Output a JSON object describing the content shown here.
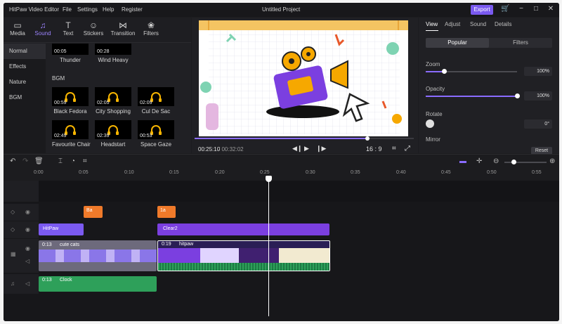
{
  "app": {
    "name": "HitPaw Video Editor",
    "menu": [
      "File",
      "Settings",
      "Help",
      "Register"
    ],
    "project_title": "Untitled Project",
    "export_label": "Export"
  },
  "media_tabs": [
    {
      "label": "Media",
      "icon": "folder-icon"
    },
    {
      "label": "Sound",
      "icon": "music-note-icon"
    },
    {
      "label": "Text",
      "icon": "text-icon"
    },
    {
      "label": "Stickers",
      "icon": "smiley-icon"
    },
    {
      "label": "Transition",
      "icon": "transition-icon"
    },
    {
      "label": "Filters",
      "icon": "filters-icon"
    }
  ],
  "active_media_tab": "Sound",
  "categories": [
    "Normal",
    "Effects",
    "Nature",
    "BGM"
  ],
  "active_category": "Normal",
  "sounds_top": [
    {
      "duration": "00:05",
      "name": "Thunder"
    },
    {
      "duration": "00:28",
      "name": "Wind Heavy"
    }
  ],
  "bgm_label": "BGM",
  "sounds_bgm": [
    {
      "duration": "00:59",
      "name": "Black Fedora"
    },
    {
      "duration": "02:05",
      "name": "City Shopping"
    },
    {
      "duration": "02:09",
      "name": "Cul De Sac"
    },
    {
      "duration": "02:49",
      "name": "Favourite Chair"
    },
    {
      "duration": "02:39",
      "name": "Headstart"
    },
    {
      "duration": "00:53",
      "name": "Space Gaze"
    }
  ],
  "preview": {
    "current_time": "00:25:10",
    "total_time": "/ 00:32:02",
    "progress": 0.79,
    "aspect_ratio": "16 : 9"
  },
  "props": {
    "tabs": [
      "View",
      "Adjust",
      "Sound",
      "Details"
    ],
    "active_tab": "View",
    "segments": [
      "Popular",
      "Filters"
    ],
    "zoom_label": "Zoom",
    "zoom_value": "100%",
    "zoom_level": 0.2,
    "opacity_label": "Opacity",
    "opacity_value": "100%",
    "opacity_level": 1.0,
    "rotate_label": "Rotate",
    "rotate_value": "0°",
    "mirror_label": "Mirror",
    "reset_label": "Reset"
  },
  "ruler_ticks": [
    "0:00",
    "0:05",
    "0:10",
    "0:15",
    "0:20",
    "0:25",
    "0:30",
    "0:35",
    "0:40",
    "0:45",
    "0:50",
    "0:55"
  ],
  "clips": {
    "sticker1": "Ba",
    "sticker2": "1a",
    "text1": "HitPaw",
    "text2": "Clear2",
    "video1_time": "0:13",
    "video1_name": "cute cats",
    "video2_time": "0:19",
    "video2_name": "hitpaw",
    "audio_time": "0:13",
    "audio_name": "Clock"
  },
  "colors": {
    "accent": "#7a5af0",
    "sticker_clip": "#f07a2a",
    "text_clip": "#7b3fe0",
    "audio_clip": "#2ea05a"
  }
}
